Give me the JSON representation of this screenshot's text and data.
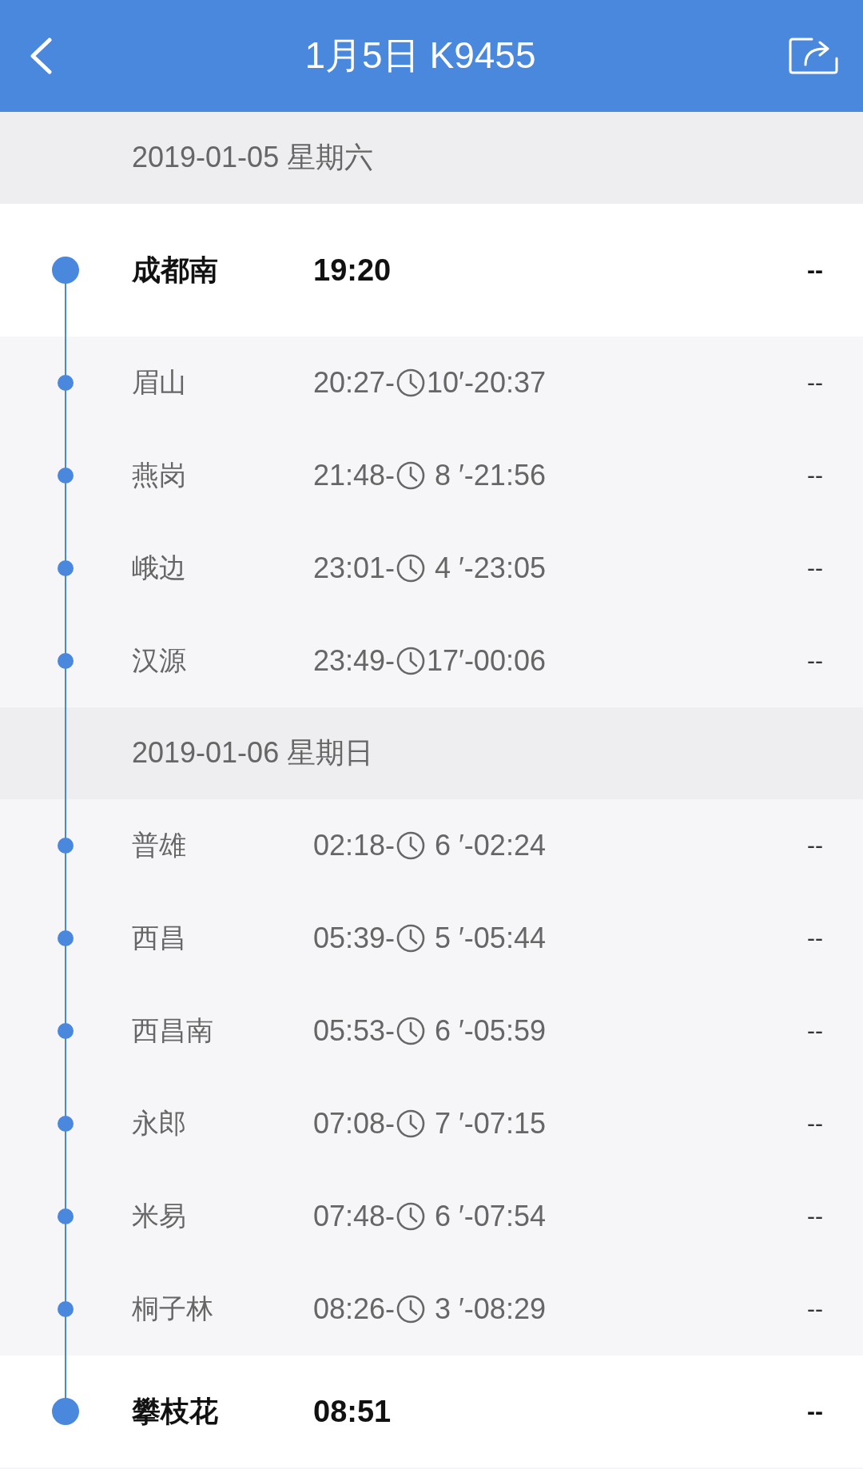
{
  "header": {
    "title": "1月5日 K9455"
  },
  "rows": [
    {
      "kind": "date",
      "text": "2019-01-05 星期六"
    },
    {
      "kind": "terminal",
      "station": "成都南",
      "time": "19:20",
      "column_3": "--"
    },
    {
      "kind": "stop",
      "station": "眉山",
      "arrival": "20:27-",
      "stop": "10′",
      "departure": "-20:37",
      "column_3": "--"
    },
    {
      "kind": "stop",
      "station": "燕岗",
      "arrival": "21:48-",
      "stop": " 8 ′",
      "departure": "-21:56",
      "column_3": "--"
    },
    {
      "kind": "stop",
      "station": "峨边",
      "arrival": "23:01-",
      "stop": " 4 ′",
      "departure": "-23:05",
      "column_3": "--"
    },
    {
      "kind": "stop",
      "station": "汉源",
      "arrival": "23:49-",
      "stop": "17′",
      "departure": "-00:06",
      "column_3": "--"
    },
    {
      "kind": "date",
      "text": "2019-01-06 星期日"
    },
    {
      "kind": "stop",
      "station": "普雄",
      "arrival": "02:18-",
      "stop": " 6 ′",
      "departure": "-02:24",
      "column_3": "--"
    },
    {
      "kind": "stop",
      "station": "西昌",
      "arrival": "05:39-",
      "stop": " 5 ′",
      "departure": "-05:44",
      "column_3": "--"
    },
    {
      "kind": "stop",
      "station": "西昌南",
      "arrival": "05:53-",
      "stop": " 6 ′",
      "departure": "-05:59",
      "column_3": "--"
    },
    {
      "kind": "stop",
      "station": "永郎",
      "arrival": "07:08-",
      "stop": " 7 ′",
      "departure": "-07:15",
      "column_3": "--"
    },
    {
      "kind": "stop",
      "station": "米易",
      "arrival": "07:48-",
      "stop": " 6 ′",
      "departure": "-07:54",
      "column_3": "--"
    },
    {
      "kind": "stop",
      "station": "桐子林",
      "arrival": "08:26-",
      "stop": " 3 ′",
      "departure": "-08:29",
      "column_3": "--"
    },
    {
      "kind": "terminal",
      "station": "攀枝花",
      "time": "08:51",
      "column_3": "--"
    }
  ]
}
